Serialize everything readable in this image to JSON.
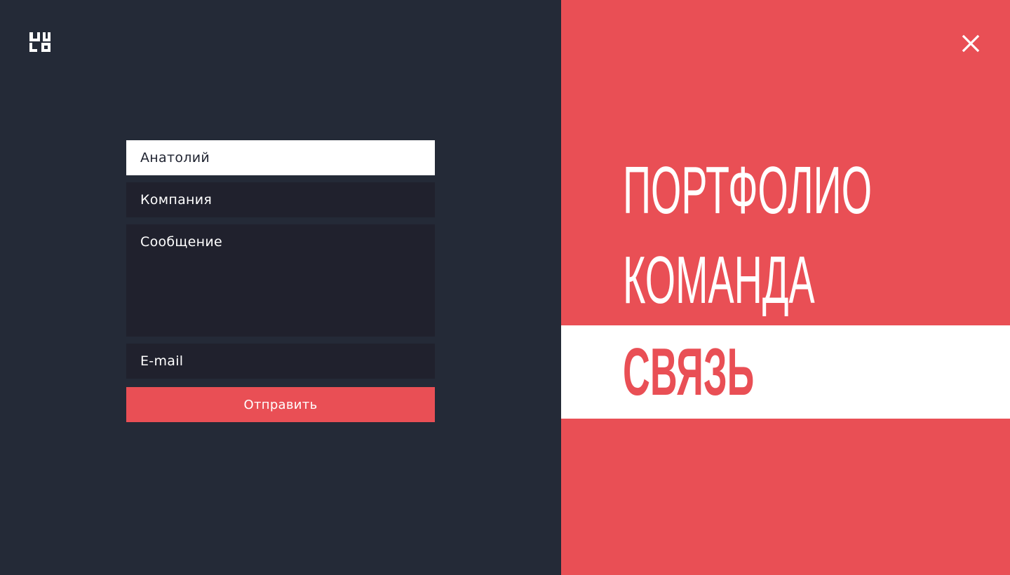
{
  "colors": {
    "left_background": "#242a37",
    "accent": "#e94f55",
    "field_background": "#20212d",
    "white": "#ffffff"
  },
  "logo": {
    "icon": "brand-logo-icon"
  },
  "form": {
    "name_value": "Анатолий",
    "company_placeholder": "Компания",
    "message_placeholder": "Сообщение",
    "email_placeholder": "E-mail",
    "submit_label": "Отправить"
  },
  "close": {
    "icon": "close-icon"
  },
  "menu": {
    "items": [
      {
        "label": "ПОРТФОЛИО",
        "active": false
      },
      {
        "label": "КОМАНДА",
        "active": false
      },
      {
        "label": "СВЯЗЬ",
        "active": true
      }
    ]
  }
}
